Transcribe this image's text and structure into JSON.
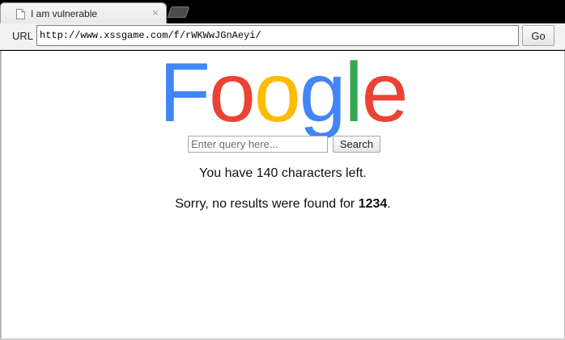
{
  "tab": {
    "title": "I am vulnerable",
    "close_glyph": "×",
    "icon": "file-icon"
  },
  "toolbar": {
    "url_label": "URL",
    "url_value": "http://www.xssgame.com/f/rWKWwJGnAeyi/",
    "go_label": "Go"
  },
  "page": {
    "logo_letters": [
      {
        "char": "F",
        "color": "#4285F4"
      },
      {
        "char": "o",
        "color": "#EA4335"
      },
      {
        "char": "o",
        "color": "#FBBC05"
      },
      {
        "char": "g",
        "color": "#4285F4"
      },
      {
        "char": "l",
        "color": "#34A853"
      },
      {
        "char": "e",
        "color": "#EA4335"
      }
    ],
    "search": {
      "placeholder": "Enter query here...",
      "value": "",
      "button_label": "Search"
    },
    "chars_left_text": "You have 140 characters left.",
    "results": {
      "prefix": "Sorry, no results were found for ",
      "query": "1234",
      "suffix": "."
    }
  }
}
